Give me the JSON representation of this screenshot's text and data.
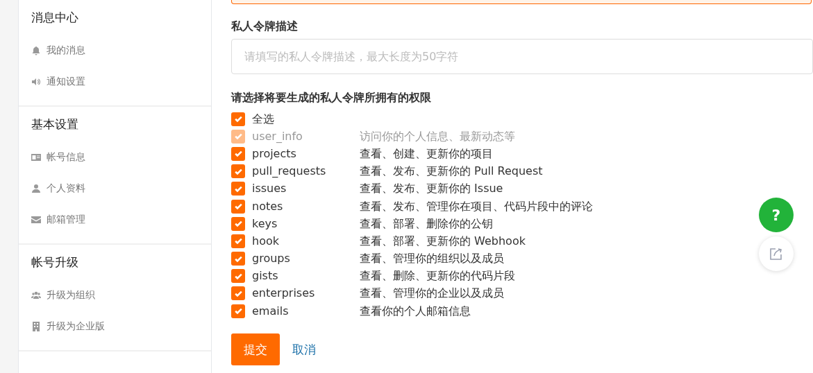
{
  "sidebar": {
    "sections": [
      {
        "title": "消息中心",
        "items": [
          {
            "label": "我的消息"
          },
          {
            "label": "通知设置"
          }
        ]
      },
      {
        "title": "基本设置",
        "items": [
          {
            "label": "帐号信息"
          },
          {
            "label": "个人资料"
          },
          {
            "label": "邮箱管理"
          }
        ]
      },
      {
        "title": "帐号升级",
        "items": [
          {
            "label": "升级为组织"
          },
          {
            "label": "升级为企业版"
          }
        ]
      }
    ]
  },
  "form": {
    "description_label": "私人令牌描述",
    "description_field": {
      "placeholder": "请填写的私人令牌描述，最大长度为50字符"
    },
    "scopes_label": "请选择将要生成的私人令牌所拥有的权限",
    "select_all": {
      "label": "全选",
      "checked": true
    },
    "scopes": [
      {
        "name": "user_info",
        "description": "访问你的个人信息、最新动态等",
        "checked": true,
        "disabled": true
      },
      {
        "name": "projects",
        "description": "查看、创建、更新你的项目",
        "checked": true,
        "disabled": false
      },
      {
        "name": "pull_requests",
        "description": "查看、发布、更新你的 Pull Request",
        "checked": true,
        "disabled": false
      },
      {
        "name": "issues",
        "description": "查看、发布、更新你的 Issue",
        "checked": true,
        "disabled": false
      },
      {
        "name": "notes",
        "description": "查看、发布、管理你在项目、代码片段中的评论",
        "checked": true,
        "disabled": false
      },
      {
        "name": "keys",
        "description": "查看、部署、删除你的公钥",
        "checked": true,
        "disabled": false
      },
      {
        "name": "hook",
        "description": "查看、部署、更新你的 Webhook",
        "checked": true,
        "disabled": false
      },
      {
        "name": "groups",
        "description": "查看、管理你的组织以及成员",
        "checked": true,
        "disabled": false
      },
      {
        "name": "gists",
        "description": "查看、删除、更新你的代码片段",
        "checked": true,
        "disabled": false
      },
      {
        "name": "enterprises",
        "description": "查看、管理你的企业以及成员",
        "checked": true,
        "disabled": false
      },
      {
        "name": "emails",
        "description": "查看你的个人邮箱信息",
        "checked": true,
        "disabled": false
      }
    ],
    "submit": "提交",
    "cancel": "取消"
  },
  "floating": {
    "help": "?"
  }
}
